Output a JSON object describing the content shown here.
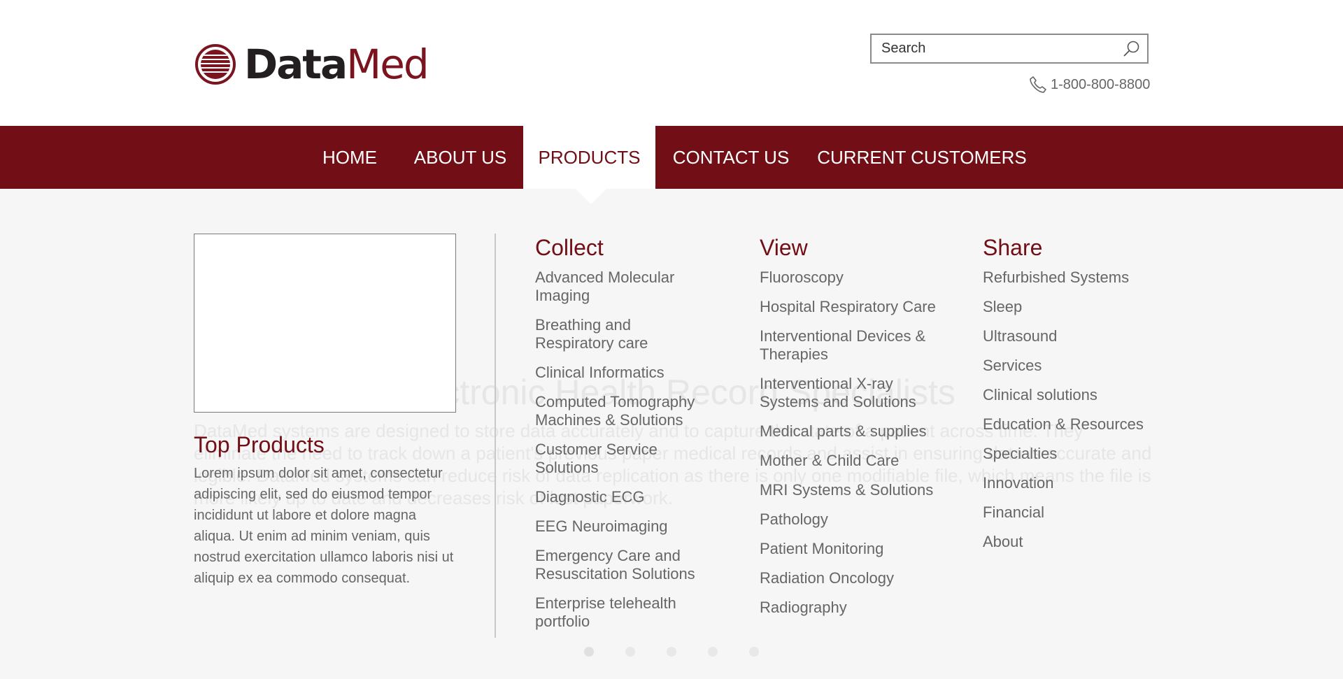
{
  "brand": {
    "name_part1": "Data",
    "name_part2": "Med",
    "accent": "#710e16",
    "logo_icon": "datamed-logo-icon"
  },
  "search": {
    "placeholder": "Search",
    "icon": "search-icon"
  },
  "phone": {
    "number": "1-800-800-8800",
    "icon": "phone-icon"
  },
  "nav": {
    "items": [
      {
        "label": "HOME",
        "active": false
      },
      {
        "label": "ABOUT US",
        "active": false
      },
      {
        "label": "PRODUCTS",
        "active": true
      },
      {
        "label": "CONTACT US",
        "active": false
      },
      {
        "label": "CURRENT CUSTOMERS",
        "active": false
      }
    ]
  },
  "background": {
    "title": "Electronic Health Record Specialists",
    "text": "DataMed systems are designed to store data accurately and to capture the state of a patient across time. They eliminate the need to track down a patient's previous paper medical records and assist in ensuring data is accurate and legible. DataMed systems can reduce risk of data replication as there is only one modifiable file, which means the file is more likely up to date and decreases risk of lost paperwork."
  },
  "mega": {
    "top_products": {
      "title": "Top Products",
      "text": "Lorem ipsum dolor sit amet, consectetur adipiscing elit, sed do eiusmod tempor incididunt ut labore et dolore magna aliqua. Ut enim ad minim veniam, quis nostrud exercitation ullamco laboris nisi ut aliquip ex ea commodo consequat."
    },
    "columns": [
      {
        "title": "Collect",
        "items": [
          "Advanced Molecular Imaging",
          "Breathing and Respiratory care",
          "Clinical Informatics",
          "Computed Tomography Machines & Solutions",
          "Customer Service Solutions",
          "Diagnostic ECG",
          "EEG Neuroimaging",
          "Emergency Care and Resuscitation Solutions",
          "Enterprise telehealth portfolio"
        ]
      },
      {
        "title": "View",
        "items": [
          "Fluoroscopy",
          "Hospital Respiratory Care",
          "Interventional Devices & Therapies",
          "Interventional X-ray Systems and Solutions",
          "Medical parts & supplies",
          "Mother & Child Care",
          "MRI Systems & Solutions",
          "Pathology",
          "Patient Monitoring",
          "Radiation Oncology",
          "Radiography"
        ]
      },
      {
        "title": "Share",
        "items": [
          "Refurbished Systems",
          "Sleep",
          "Ultrasound",
          "Services",
          "Clinical solutions",
          "Education & Resources",
          "Specialties",
          "Innovation",
          "Financial",
          "About"
        ]
      }
    ]
  },
  "carousel": {
    "count": 5,
    "active_index": 0
  }
}
